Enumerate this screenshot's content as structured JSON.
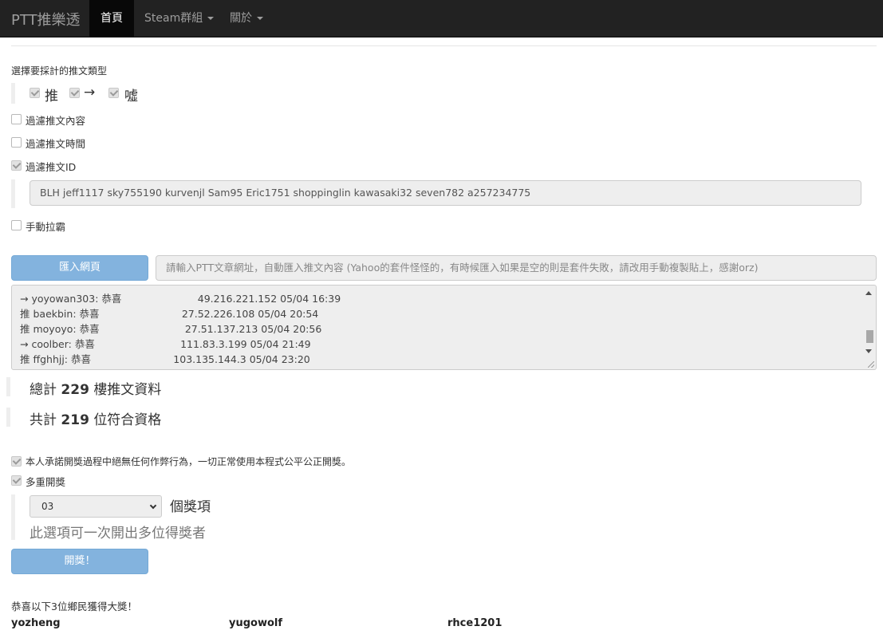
{
  "navbar": {
    "brand": "PTT推樂透",
    "items": [
      {
        "label": "首頁",
        "active": true,
        "dropdown": false
      },
      {
        "label": "Steam群組",
        "active": false,
        "dropdown": true
      },
      {
        "label": "關於",
        "active": false,
        "dropdown": true
      }
    ]
  },
  "filter": {
    "title": "選擇要採計的推文類型",
    "types": [
      {
        "label": "推",
        "checked": true
      },
      {
        "label": "→",
        "checked": true
      },
      {
        "label": "噓",
        "checked": true
      }
    ],
    "content_filter": {
      "label": "過濾推文內容",
      "checked": false
    },
    "time_filter": {
      "label": "過濾推文時間",
      "checked": false
    },
    "id_filter": {
      "label": "過濾推文ID",
      "checked": true
    },
    "id_list": "BLH jeff1117 sky755190 kurvenjl Sam95 Eric1751 shoppinglin kawasaki32 seven782 a257234775",
    "manual": {
      "label": "手動拉霸",
      "checked": false
    }
  },
  "import": {
    "button_label": "匯入網頁",
    "url_placeholder": "請輸入PTT文章網址，自動匯入推文內容 (Yahoo的套件怪怪的，有時候匯入如果是空的則是套件失敗，請改用手動複製貼上，感謝orz)"
  },
  "comments": [
    "→ yoyowan303: 恭喜                        49.216.221.152 05/04 16:39",
    "推 baekbin: 恭喜                          27.52.226.108 05/04 20:54",
    "推 moyoyo: 恭喜                           27.51.137.213 05/04 20:56",
    "→ coolber: 恭喜                           111.83.3.199 05/04 21:49",
    "推 ffghhjj: 恭喜                          103.135.144.3 05/04 23:20"
  ],
  "stats": {
    "total_prefix": "總計",
    "total_count": "229",
    "total_suffix": "樓推文資料",
    "eligible_prefix": "共計",
    "eligible_count": "219",
    "eligible_suffix": "位符合資格"
  },
  "draw": {
    "pledge": {
      "label": "本人承諾開獎過程中絕無任何作弊行為，一切正常使用本程式公平公正開獎。",
      "checked": true
    },
    "multi": {
      "label": "多重開獎",
      "checked": true
    },
    "prize_count": "03",
    "prize_unit": "個獎項",
    "multi_hint": "此選項可一次開出多位得獎者",
    "button_label": "開獎！"
  },
  "result": {
    "title": "恭喜以下3位鄉民獲得大獎！",
    "winners": [
      "yozheng",
      "yugowolf",
      "rhce1201"
    ]
  }
}
